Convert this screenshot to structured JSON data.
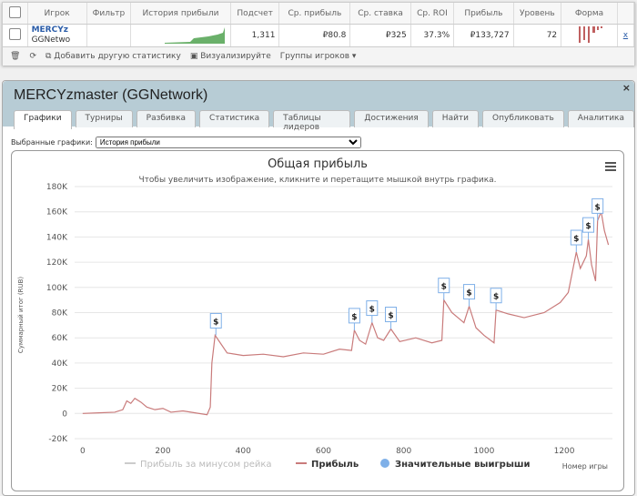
{
  "table": {
    "headers": [
      "Игрок",
      "Фильтр",
      "История прибыли",
      "Подсчет",
      "Ср. прибыль",
      "Ср. ставка",
      "Ср. ROI",
      "Прибыль",
      "Уровень",
      "Форма"
    ],
    "row": {
      "player": "MERCYz",
      "network": "GGNetwo",
      "count": "1,311",
      "avg_profit": "₽80.8",
      "avg_stake": "₽325",
      "avg_roi": "37.3%",
      "profit": "₽133,727",
      "level": "72",
      "remove": "x"
    }
  },
  "toolbar": {
    "add_stat": "Добавить другую статистику",
    "visualize": "Визуализируйте",
    "groups": "Группы игроков"
  },
  "window": {
    "title": "MERCYzmaster (GGNetwork)",
    "close": "×",
    "tabs": [
      "Графики",
      "Турниры",
      "Разбивка",
      "Статистика",
      "Таблицы лидеров",
      "Достижения",
      "Найти",
      "Опубликовать",
      "Аналитика"
    ],
    "active_tab": "Графики",
    "selected_label": "Выбранные графики:",
    "selected_value": "История прибыли"
  },
  "colors": {
    "profit": "#c97b7b",
    "markers": "#7fb0e8",
    "header": "#b7ccd5"
  },
  "chart_data": {
    "type": "line",
    "title": "Общая прибыль",
    "subtitle": "Чтобы увеличить изображение, кликните и перетащите мышкой внутрь графика.",
    "xlabel": "Номер игры",
    "ylabel": "Суммарный итог (RUB)",
    "xlim": [
      -20,
      1320
    ],
    "ylim": [
      -20000,
      180000
    ],
    "xticks": [
      0,
      200,
      400,
      600,
      800,
      1000,
      1200
    ],
    "yticks": [
      "-20K",
      "0",
      "20K",
      "40K",
      "60K",
      "80K",
      "100K",
      "120K",
      "140K",
      "160K",
      "180K"
    ],
    "legend": [
      "Прибыль за минусом рейка",
      "Прибыль",
      "Значительные выигрыши"
    ],
    "legend_placement": "bottom",
    "series": [
      {
        "name": "Прибыль",
        "points": [
          [
            0,
            0
          ],
          [
            40,
            500
          ],
          [
            80,
            1000
          ],
          [
            100,
            3000
          ],
          [
            110,
            10000
          ],
          [
            120,
            8000
          ],
          [
            130,
            12000
          ],
          [
            145,
            9000
          ],
          [
            160,
            5000
          ],
          [
            180,
            3000
          ],
          [
            200,
            4000
          ],
          [
            220,
            1000
          ],
          [
            250,
            2000
          ],
          [
            280,
            500
          ],
          [
            310,
            -1000
          ],
          [
            318,
            5000
          ],
          [
            322,
            40000
          ],
          [
            330,
            62000
          ],
          [
            345,
            55000
          ],
          [
            360,
            48000
          ],
          [
            400,
            46000
          ],
          [
            450,
            47000
          ],
          [
            500,
            45000
          ],
          [
            550,
            48000
          ],
          [
            600,
            47000
          ],
          [
            640,
            51000
          ],
          [
            670,
            50000
          ],
          [
            677,
            66000
          ],
          [
            690,
            58000
          ],
          [
            705,
            55000
          ],
          [
            721,
            72000
          ],
          [
            735,
            60000
          ],
          [
            750,
            58000
          ],
          [
            768,
            67000
          ],
          [
            790,
            57000
          ],
          [
            830,
            60000
          ],
          [
            870,
            56000
          ],
          [
            895,
            58000
          ],
          [
            900,
            90000
          ],
          [
            920,
            80000
          ],
          [
            950,
            72000
          ],
          [
            963,
            85000
          ],
          [
            980,
            68000
          ],
          [
            1000,
            62000
          ],
          [
            1025,
            56000
          ],
          [
            1030,
            82000
          ],
          [
            1060,
            79000
          ],
          [
            1100,
            76000
          ],
          [
            1150,
            80000
          ],
          [
            1190,
            88000
          ],
          [
            1210,
            96000
          ],
          [
            1225,
            120000
          ],
          [
            1230,
            128000
          ],
          [
            1240,
            115000
          ],
          [
            1255,
            125000
          ],
          [
            1260,
            138000
          ],
          [
            1268,
            118000
          ],
          [
            1278,
            105000
          ],
          [
            1283,
            153000
          ],
          [
            1292,
            160000
          ],
          [
            1300,
            145000
          ],
          [
            1310,
            133727
          ]
        ]
      }
    ],
    "markers": {
      "label": "$",
      "x": [
        332,
        677,
        721,
        768,
        900,
        963,
        1030,
        1230,
        1260,
        1283
      ],
      "y": [
        62000,
        66000,
        72000,
        67000,
        90000,
        85000,
        82000,
        128000,
        138000,
        153000
      ]
    }
  }
}
